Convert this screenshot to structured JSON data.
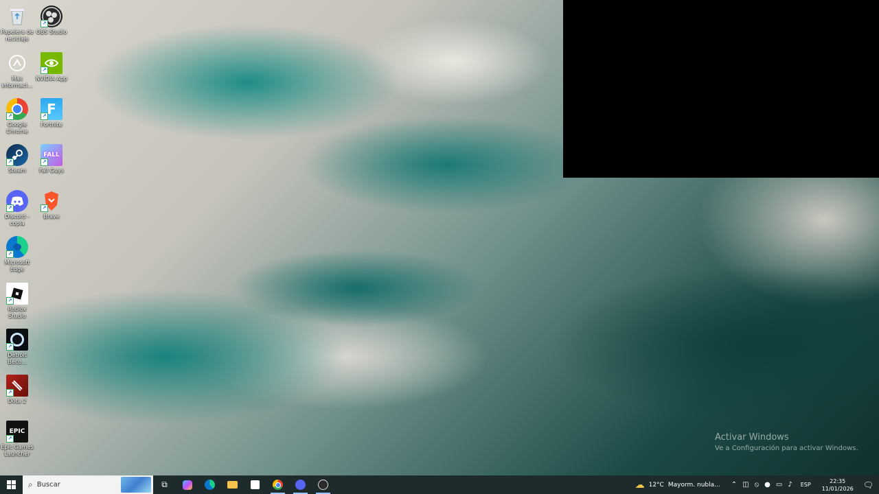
{
  "desktop": {
    "icons": [
      {
        "label": "Papelera de\nreciclaje",
        "icon": "recycle-bin-icon"
      },
      {
        "label": "OBS Studio",
        "icon": "obs-icon"
      },
      {
        "label": "Mas\ninformaci...",
        "icon": "info-icon"
      },
      {
        "label": "NVIDIA App",
        "icon": "nvidia-icon"
      },
      {
        "label": "Google\nChrome",
        "icon": "chrome-icon"
      },
      {
        "label": "Fortnite",
        "icon": "fortnite-icon"
      },
      {
        "label": "Steam",
        "icon": "steam-icon"
      },
      {
        "label": "Fall Guys",
        "icon": "fall-guys-icon"
      },
      {
        "label": "Discord -\ncopia",
        "icon": "discord-icon"
      },
      {
        "label": "Brave",
        "icon": "brave-icon"
      },
      {
        "label": "Microsoft\nEdge",
        "icon": "edge-icon"
      },
      {
        "label": "Roblox\nStudio",
        "icon": "roblox-studio-icon"
      },
      {
        "label": "Detroit\nBeco...",
        "icon": "detroit-icon"
      },
      {
        "label": "Dota 2",
        "icon": "dota2-icon"
      },
      {
        "label": "Epic Games\nLauncher",
        "icon": "epic-games-icon"
      }
    ]
  },
  "watermark": {
    "title": "Activar Windows",
    "subtitle": "Ve a Configuración para activar Windows."
  },
  "taskbar": {
    "search_placeholder": "Buscar",
    "weather_temp": "12°C",
    "weather_text": "Mayorm. nubla...",
    "language": "ESP",
    "time": "22:35",
    "date": "11/01/2026"
  },
  "colors": {
    "taskbar": "#1d2b2d",
    "black_panel": "#000000"
  }
}
